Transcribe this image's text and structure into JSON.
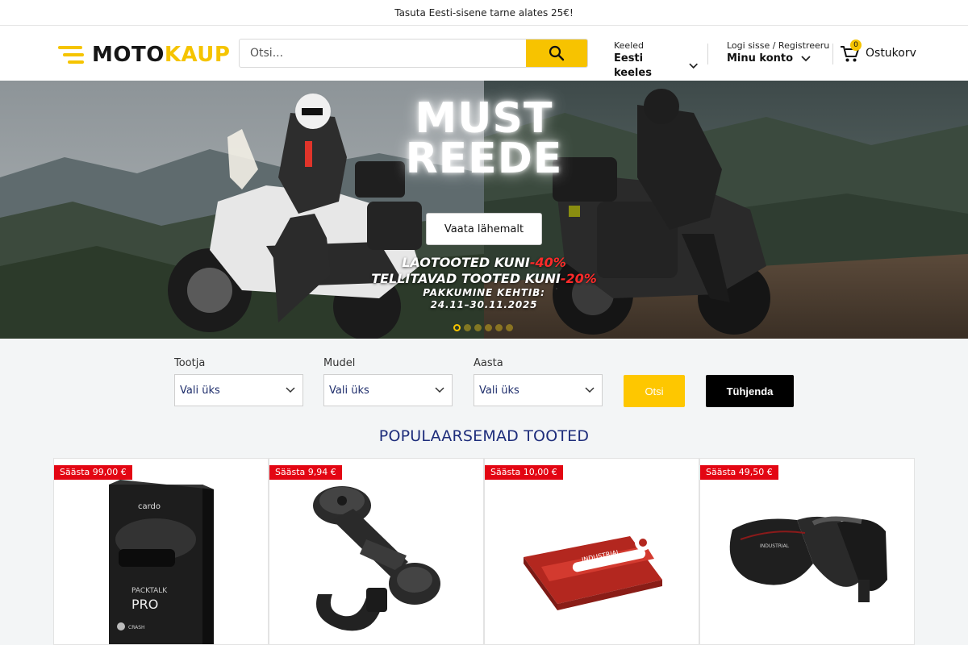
{
  "topbar": {
    "text": "Tasuta Eesti-sisene tarne alates 25€!"
  },
  "header": {
    "logo": {
      "part1": "MOTO",
      "part2": "KAUP"
    },
    "search": {
      "placeholder": "Otsi..."
    },
    "language": {
      "label": "Keeled",
      "value": "Eesti keeles"
    },
    "account": {
      "label": "Logi sisse / Registreeru",
      "value": "Minu konto"
    },
    "cart": {
      "count": "0",
      "label": "Ostukorv"
    }
  },
  "hero": {
    "title_line1": "MUST",
    "title_line2": "REEDE",
    "button": "Vaata lähemalt",
    "promo_line1_text": "LAOTOOTED KUNI",
    "promo_line1_value": "-40%",
    "promo_line2_text": "TELLITAVAD TOOTED KUNI",
    "promo_line2_value": "-20%",
    "promo_line3": "PAKKUMINE KEHTIB:",
    "promo_line4": "24.11–30.11.2025",
    "slide_count": 6,
    "active_slide": 1
  },
  "filters": {
    "manufacturer": {
      "label": "Tootja",
      "value": "Vali üks"
    },
    "model": {
      "label": "Mudel",
      "value": "Vali üks"
    },
    "year": {
      "label": "Aasta",
      "value": "Vali üks"
    },
    "search_button": "Otsi",
    "clear_button": "Tühjenda"
  },
  "popular": {
    "title": "POPULAARSEMAD TOOTED",
    "products": [
      {
        "badge": "Säästa 99,00 €"
      },
      {
        "badge": "Säästa 9,94 €"
      },
      {
        "badge": "Säästa 10,00 €"
      },
      {
        "badge": "Säästa 49,50 €"
      }
    ]
  },
  "colors": {
    "brand_yellow": "#f5c400",
    "sale_red": "#e30613",
    "heading_blue": "#1e2d7b"
  },
  "icons": [
    "search-icon",
    "chevron-down-icon",
    "cart-icon"
  ]
}
